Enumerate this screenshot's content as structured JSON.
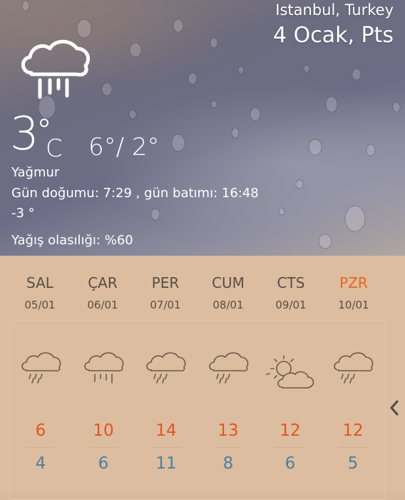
{
  "header": {
    "location": "Istanbul, Turkey",
    "date": "4 Ocak, Pts"
  },
  "current": {
    "temp": "3",
    "unit": "C",
    "high_low": "6°/ 2°",
    "condition": "Yağmur",
    "sun_times": "Gün doğumu: 7:29 , gün batımı: 16:48",
    "feels_like": "-3 °",
    "rain_chance": "Yağış olasılığı: %60",
    "icon": "cloud-rain-icon"
  },
  "forecast": [
    {
      "day": "SAL",
      "date": "05/01",
      "high": "6",
      "low": "4",
      "icon": "rain-icon"
    },
    {
      "day": "ÇAR",
      "date": "06/01",
      "high": "10",
      "low": "6",
      "icon": "heavy-rain-icon"
    },
    {
      "day": "PER",
      "date": "07/01",
      "high": "14",
      "low": "11",
      "icon": "rain-icon"
    },
    {
      "day": "CUM",
      "date": "08/01",
      "high": "13",
      "low": "8",
      "icon": "rain-icon"
    },
    {
      "day": "CTS",
      "date": "09/01",
      "high": "12",
      "low": "6",
      "icon": "partly-sunny-icon"
    },
    {
      "day": "PZR",
      "date": "10/01",
      "high": "12",
      "low": "5",
      "icon": "rain-icon"
    }
  ],
  "colors": {
    "accent_orange": "#e1561c",
    "low_blue": "#4b7fa3",
    "panel_bg": "#dcbd9f",
    "sunday": "#e8651f"
  }
}
